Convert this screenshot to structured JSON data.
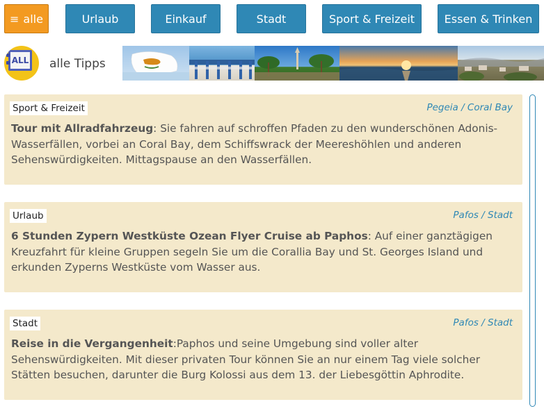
{
  "nav": {
    "items": [
      {
        "label": "alle",
        "active": true,
        "icon": "menu-icon"
      },
      {
        "label": "Urlaub",
        "active": false
      },
      {
        "label": "Einkauf",
        "active": false
      },
      {
        "label": "Stadt",
        "active": false
      },
      {
        "label": "Sport & Freizeit",
        "active": false
      },
      {
        "label": "Essen & Trinken",
        "active": false
      }
    ],
    "colors": {
      "active": "#f39a21",
      "default": "#2f88b5"
    }
  },
  "header": {
    "logo_text": "ALL",
    "label": "alle Tipps"
  },
  "cards": [
    {
      "category": "Sport & Freizeit",
      "location": "Pegeia / Coral Bay",
      "title": "Tour mit Allradfahrzeug",
      "separator": ": ",
      "text": "Sie fahren auf schroffen Pfaden zu den wunderschönen Adonis-Wasserfällen, vorbei an Coral Bay, dem Schiffswrack der Meereshöhlen und anderen Sehenswürdigkeiten. Mittagspause an den Wasserfällen."
    },
    {
      "category": "Urlaub",
      "location": "Pafos / Stadt",
      "title": "6 Stunden Zypern Westküste Ozean Flyer Cruise ab Paphos",
      "separator": ": ",
      "text": "Auf einer ganztägigen Kreuzfahrt für kleine Gruppen segeln Sie um die Corallia Bay und St. Georges Island und erkunden Zyperns Westküste vom Wasser aus."
    },
    {
      "category": "Stadt",
      "location": "Pafos / Stadt",
      "title": "Reise in die Vergangenheit",
      "separator": ":",
      "text": "Paphos und seine Umgebung sind voller alter Sehenswürdigkeiten. Mit dieser privaten Tour können Sie an nur einem Tag viele solcher Stätten besuchen, darunter die Burg Kolossi aus dem 13. der Liebesgöttin Aphrodite."
    }
  ]
}
